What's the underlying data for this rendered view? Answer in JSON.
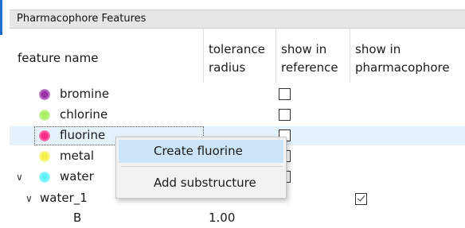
{
  "panel": {
    "title": "Pharmacophore Features"
  },
  "columns": {
    "feature_name": "feature name",
    "tolerance_l1": "tolerance",
    "tolerance_l2": "radius",
    "show_ref_l1": "show in",
    "show_ref_l2": "reference",
    "show_pharm_l1": "show in",
    "show_pharm_l2": "pharmacophore"
  },
  "rows": [
    {
      "name": "bromine",
      "color": "#9b2fa8"
    },
    {
      "name": "chlorine",
      "color": "#a8f060"
    },
    {
      "name": "fluorine",
      "color": "#ff2a86"
    },
    {
      "name": "metal",
      "color": "#f4f04a"
    },
    {
      "name": "water",
      "color": "#5ef0f8"
    },
    {
      "name": "water_1"
    },
    {
      "name": "B",
      "tolerance": "1.00"
    }
  ],
  "context_menu": {
    "create": "Create fluorine",
    "add_substructure": "Add substructure"
  },
  "colors": {
    "selection": "#e5f1fb",
    "menu_highlight": "#cce4f7",
    "accent": "#1f6fd1"
  }
}
